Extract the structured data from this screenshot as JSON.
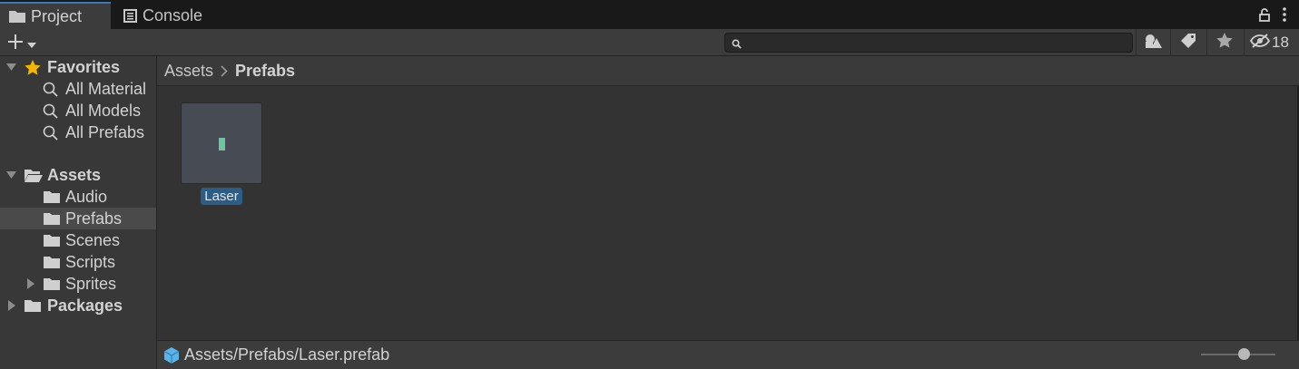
{
  "tabs": [
    {
      "label": "Project",
      "icon": "folder-icon",
      "active": true
    },
    {
      "label": "Console",
      "icon": "console-icon",
      "active": false
    }
  ],
  "toolbar": {
    "add_icon": "plus-icon",
    "search": {
      "value": "",
      "placeholder": ""
    },
    "hidden_packages_count": "18"
  },
  "sidebar": {
    "favorites": {
      "label": "Favorites",
      "items": [
        {
          "label": "All Material"
        },
        {
          "label": "All Models"
        },
        {
          "label": "All Prefabs"
        }
      ]
    },
    "assets": {
      "label": "Assets",
      "items": [
        {
          "label": "Audio",
          "selected": false
        },
        {
          "label": "Prefabs",
          "selected": true
        },
        {
          "label": "Scenes",
          "selected": false
        },
        {
          "label": "Scripts",
          "selected": false
        },
        {
          "label": "Sprites",
          "selected": false,
          "expandable": true
        }
      ]
    },
    "packages": {
      "label": "Packages"
    }
  },
  "breadcrumb": [
    "Assets",
    "Prefabs"
  ],
  "content": {
    "items": [
      {
        "label": "Laser",
        "selected": true
      }
    ]
  },
  "status": {
    "path": "Assets/Prefabs/Laser.prefab",
    "zoom_fraction": 0.58
  },
  "colors": {
    "accent": "#3a79bb",
    "selection": "#2c5d87",
    "prefab_cube": "#5ab4e8",
    "star": "#f4b400"
  }
}
